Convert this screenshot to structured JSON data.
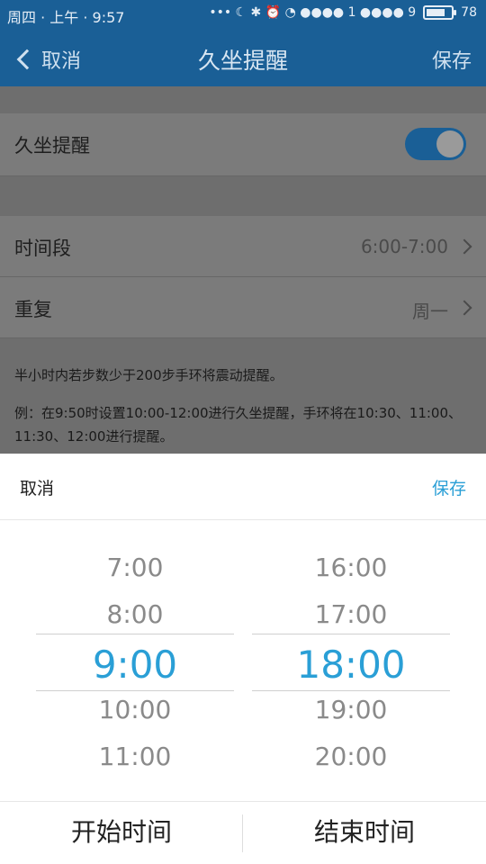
{
  "status": {
    "left": "周四 · 上午 · 9:57",
    "right_text": "••• ☾ ✱ ⏰ ◔ ●●●● 1 ●●●● 9",
    "battery": "78",
    "battery_level": 0.78
  },
  "nav": {
    "back_label": "取消",
    "title": "久坐提醒",
    "save_label": "保存"
  },
  "settings": {
    "reminder_label": "久坐提醒",
    "reminder_on": true,
    "time_label": "时间段",
    "time_value": "6:00-7:00",
    "repeat_label": "重复",
    "repeat_value": "周一",
    "note1": "半小时内若步数少于200步手环将震动提醒。",
    "note2": "例：在9:50时设置10:00-12:00进行久坐提醒，手环将在10:30、11:00、11:30、12:00进行提醒。"
  },
  "picker": {
    "cancel_label": "取消",
    "save_label": "保存",
    "start_options": [
      "7:00",
      "8:00",
      "9:00",
      "10:00",
      "11:00"
    ],
    "end_options": [
      "16:00",
      "17:00",
      "18:00",
      "19:00",
      "20:00"
    ],
    "start_selected": "9:00",
    "end_selected": "18:00",
    "tab_start": "开始时间",
    "tab_end": "结束时间"
  },
  "colors": {
    "accent": "#2a9fd6",
    "nav_bg": "#1a5f96"
  }
}
